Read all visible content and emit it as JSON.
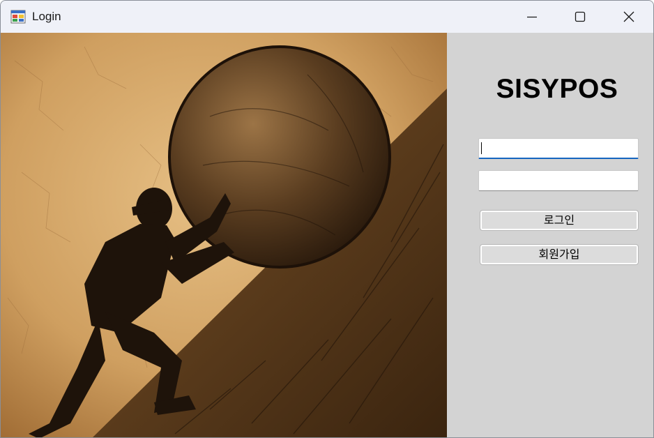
{
  "window": {
    "title": "Login",
    "icon": "app-form-icon",
    "controls": [
      "minimize-icon",
      "maximize-icon",
      "close-icon"
    ]
  },
  "artwork": {
    "description_icon": "sisyphus-illustration"
  },
  "login_panel": {
    "brand_title": "SISYPOS",
    "username": {
      "value": "",
      "placeholder": ""
    },
    "password": {
      "value": "",
      "placeholder": ""
    },
    "login_button_label": "로그인",
    "signup_button_label": "회원가입"
  },
  "colors": {
    "titlebar": "#eff1f8",
    "panel": "#d3d3d3",
    "focus_accent": "#1565c0",
    "parchment": "#c79a5b"
  }
}
